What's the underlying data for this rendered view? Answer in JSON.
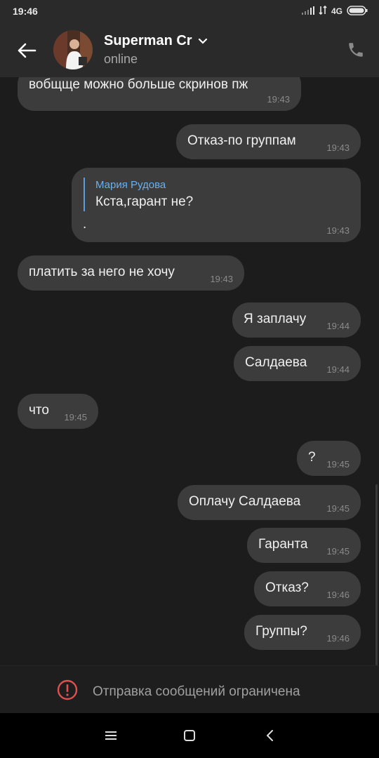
{
  "status_bar": {
    "time": "19:46",
    "network": "4G",
    "icons": [
      "signal-icon",
      "data-arrows-icon",
      "battery-icon"
    ]
  },
  "header": {
    "contact_name": "Superman Cr",
    "status": "online",
    "icons": [
      "back-arrow-icon",
      "chevron-down-icon",
      "phone-icon"
    ]
  },
  "messages": [
    {
      "direction": "in",
      "text": "вобщще можно больше скринов пж",
      "time": "19:43"
    },
    {
      "direction": "out",
      "text": "Отказ-по группам",
      "time": "19:43"
    },
    {
      "direction": "out",
      "reply_to": "Мария Рудова",
      "text": "Кста,гарант не?",
      "extra": ".",
      "time": "19:43"
    },
    {
      "direction": "in",
      "text": "платить за него не хочу",
      "time": "19:43"
    },
    {
      "direction": "out",
      "text": "Я заплачу",
      "time": "19:44"
    },
    {
      "direction": "out",
      "text": "Салдаева",
      "time": "19:44"
    },
    {
      "direction": "in",
      "text": "что",
      "time": "19:45"
    },
    {
      "direction": "out",
      "text": "?",
      "time": "19:45"
    },
    {
      "direction": "out",
      "text": "Оплачу Салдаева",
      "time": "19:45"
    },
    {
      "direction": "out",
      "text": "Гаранта",
      "time": "19:45"
    },
    {
      "direction": "out",
      "text": "Отказ?",
      "time": "19:46"
    },
    {
      "direction": "out",
      "text": "Группы?",
      "time": "19:46"
    }
  ],
  "footer": {
    "notice": "Отправка сообщений ограничена",
    "icon": "warning-circle-icon",
    "accent_color": "#e05050"
  },
  "nav_bar": {
    "icons": [
      "menu-icon",
      "home-icon",
      "back-icon"
    ]
  },
  "colors": {
    "background": "#1c1c1c",
    "bubble": "#3c3c3c",
    "header": "#2a2a2a",
    "reply_accent": "#6ab0ef"
  }
}
